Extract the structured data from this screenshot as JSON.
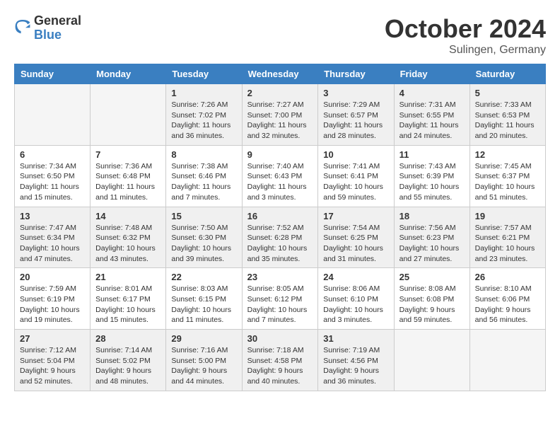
{
  "header": {
    "logo_general": "General",
    "logo_blue": "Blue",
    "month_title": "October 2024",
    "location": "Sulingen, Germany"
  },
  "weekdays": [
    "Sunday",
    "Monday",
    "Tuesday",
    "Wednesday",
    "Thursday",
    "Friday",
    "Saturday"
  ],
  "weeks": [
    [
      {
        "day": "",
        "info": ""
      },
      {
        "day": "",
        "info": ""
      },
      {
        "day": "1",
        "info": "Sunrise: 7:26 AM\nSunset: 7:02 PM\nDaylight: 11 hours and 36 minutes."
      },
      {
        "day": "2",
        "info": "Sunrise: 7:27 AM\nSunset: 7:00 PM\nDaylight: 11 hours and 32 minutes."
      },
      {
        "day": "3",
        "info": "Sunrise: 7:29 AM\nSunset: 6:57 PM\nDaylight: 11 hours and 28 minutes."
      },
      {
        "day": "4",
        "info": "Sunrise: 7:31 AM\nSunset: 6:55 PM\nDaylight: 11 hours and 24 minutes."
      },
      {
        "day": "5",
        "info": "Sunrise: 7:33 AM\nSunset: 6:53 PM\nDaylight: 11 hours and 20 minutes."
      }
    ],
    [
      {
        "day": "6",
        "info": "Sunrise: 7:34 AM\nSunset: 6:50 PM\nDaylight: 11 hours and 15 minutes."
      },
      {
        "day": "7",
        "info": "Sunrise: 7:36 AM\nSunset: 6:48 PM\nDaylight: 11 hours and 11 minutes."
      },
      {
        "day": "8",
        "info": "Sunrise: 7:38 AM\nSunset: 6:46 PM\nDaylight: 11 hours and 7 minutes."
      },
      {
        "day": "9",
        "info": "Sunrise: 7:40 AM\nSunset: 6:43 PM\nDaylight: 11 hours and 3 minutes."
      },
      {
        "day": "10",
        "info": "Sunrise: 7:41 AM\nSunset: 6:41 PM\nDaylight: 10 hours and 59 minutes."
      },
      {
        "day": "11",
        "info": "Sunrise: 7:43 AM\nSunset: 6:39 PM\nDaylight: 10 hours and 55 minutes."
      },
      {
        "day": "12",
        "info": "Sunrise: 7:45 AM\nSunset: 6:37 PM\nDaylight: 10 hours and 51 minutes."
      }
    ],
    [
      {
        "day": "13",
        "info": "Sunrise: 7:47 AM\nSunset: 6:34 PM\nDaylight: 10 hours and 47 minutes."
      },
      {
        "day": "14",
        "info": "Sunrise: 7:48 AM\nSunset: 6:32 PM\nDaylight: 10 hours and 43 minutes."
      },
      {
        "day": "15",
        "info": "Sunrise: 7:50 AM\nSunset: 6:30 PM\nDaylight: 10 hours and 39 minutes."
      },
      {
        "day": "16",
        "info": "Sunrise: 7:52 AM\nSunset: 6:28 PM\nDaylight: 10 hours and 35 minutes."
      },
      {
        "day": "17",
        "info": "Sunrise: 7:54 AM\nSunset: 6:25 PM\nDaylight: 10 hours and 31 minutes."
      },
      {
        "day": "18",
        "info": "Sunrise: 7:56 AM\nSunset: 6:23 PM\nDaylight: 10 hours and 27 minutes."
      },
      {
        "day": "19",
        "info": "Sunrise: 7:57 AM\nSunset: 6:21 PM\nDaylight: 10 hours and 23 minutes."
      }
    ],
    [
      {
        "day": "20",
        "info": "Sunrise: 7:59 AM\nSunset: 6:19 PM\nDaylight: 10 hours and 19 minutes."
      },
      {
        "day": "21",
        "info": "Sunrise: 8:01 AM\nSunset: 6:17 PM\nDaylight: 10 hours and 15 minutes."
      },
      {
        "day": "22",
        "info": "Sunrise: 8:03 AM\nSunset: 6:15 PM\nDaylight: 10 hours and 11 minutes."
      },
      {
        "day": "23",
        "info": "Sunrise: 8:05 AM\nSunset: 6:12 PM\nDaylight: 10 hours and 7 minutes."
      },
      {
        "day": "24",
        "info": "Sunrise: 8:06 AM\nSunset: 6:10 PM\nDaylight: 10 hours and 3 minutes."
      },
      {
        "day": "25",
        "info": "Sunrise: 8:08 AM\nSunset: 6:08 PM\nDaylight: 9 hours and 59 minutes."
      },
      {
        "day": "26",
        "info": "Sunrise: 8:10 AM\nSunset: 6:06 PM\nDaylight: 9 hours and 56 minutes."
      }
    ],
    [
      {
        "day": "27",
        "info": "Sunrise: 7:12 AM\nSunset: 5:04 PM\nDaylight: 9 hours and 52 minutes."
      },
      {
        "day": "28",
        "info": "Sunrise: 7:14 AM\nSunset: 5:02 PM\nDaylight: 9 hours and 48 minutes."
      },
      {
        "day": "29",
        "info": "Sunrise: 7:16 AM\nSunset: 5:00 PM\nDaylight: 9 hours and 44 minutes."
      },
      {
        "day": "30",
        "info": "Sunrise: 7:18 AM\nSunset: 4:58 PM\nDaylight: 9 hours and 40 minutes."
      },
      {
        "day": "31",
        "info": "Sunrise: 7:19 AM\nSunset: 4:56 PM\nDaylight: 9 hours and 36 minutes."
      },
      {
        "day": "",
        "info": ""
      },
      {
        "day": "",
        "info": ""
      }
    ]
  ]
}
